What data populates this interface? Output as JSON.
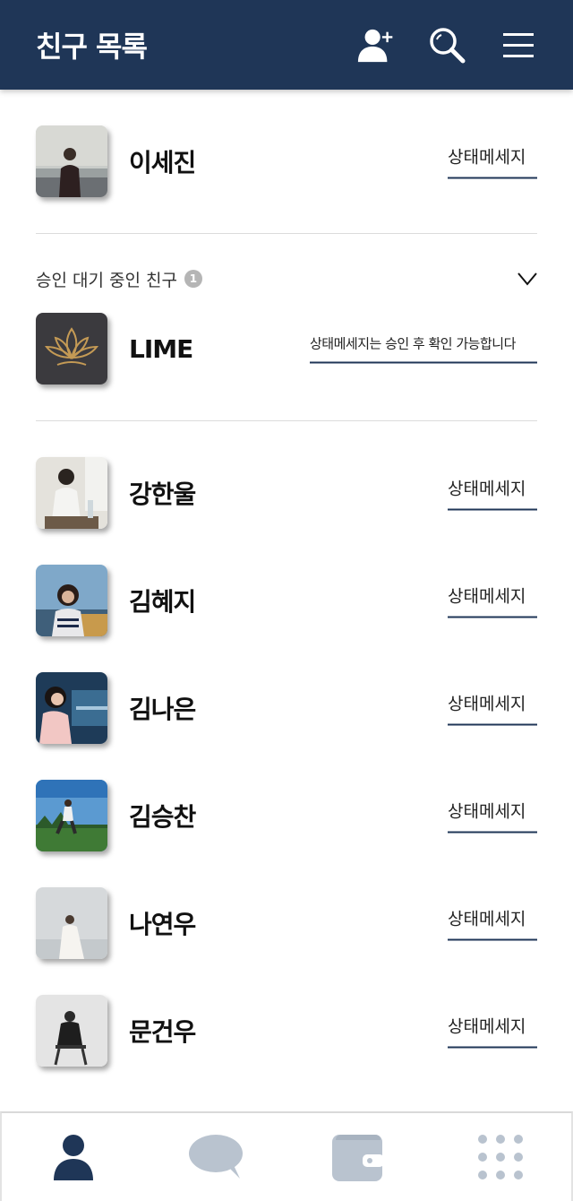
{
  "header": {
    "title": "친구 목록",
    "icons": [
      "add-friend-icon",
      "search-icon",
      "menu-icon"
    ]
  },
  "me": {
    "name": "이세진",
    "status": "상태메세지"
  },
  "pending": {
    "label": "승인 대기 중인 친구",
    "count": "1",
    "items": [
      {
        "name": "LIME",
        "status": "상태메세지는 승인 후 확인 가능합니다"
      }
    ]
  },
  "friends": [
    {
      "name": "강한울",
      "status": "상태메세지"
    },
    {
      "name": "김혜지",
      "status": "상태메세지"
    },
    {
      "name": "김나은",
      "status": "상태메세지"
    },
    {
      "name": "김승찬",
      "status": "상태메세지"
    },
    {
      "name": "나연우",
      "status": "상태메세지"
    },
    {
      "name": "문건우",
      "status": "상태메세지"
    }
  ],
  "bottom_nav": [
    "friends-tab-icon",
    "chat-tab-icon",
    "wallet-tab-icon",
    "more-tab-icon"
  ],
  "colors": {
    "primary": "#1f3657",
    "inactive": "#b9c3cf",
    "divider": "#dcdcdc",
    "badge": "#b5b5b5"
  }
}
